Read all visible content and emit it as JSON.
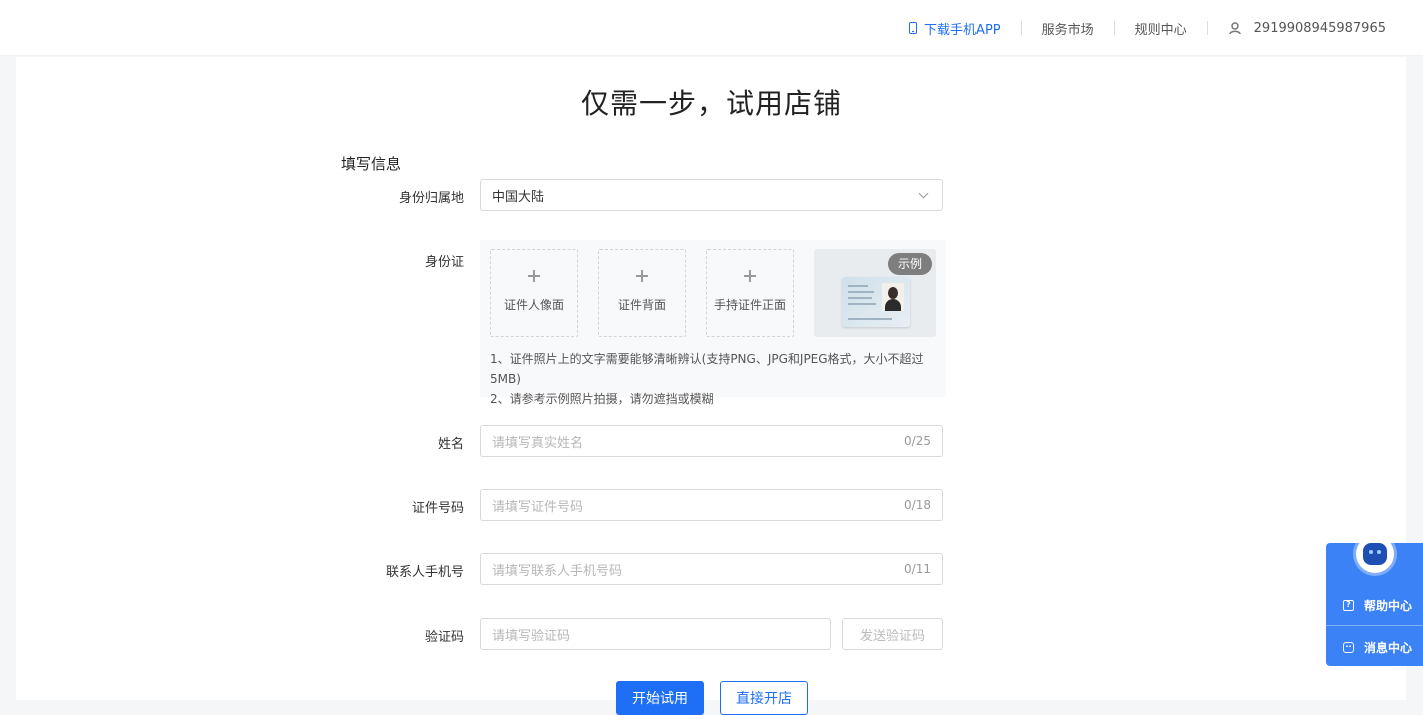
{
  "header": {
    "download_app": "下载手机APP",
    "service_market": "服务市场",
    "rules_center": "规则中心",
    "user_id": "2919908945987965"
  },
  "page": {
    "title": "仅需一步，试用店铺"
  },
  "form": {
    "section_title": "填写信息",
    "region": {
      "label": "身份归属地",
      "value": "中国大陆"
    },
    "id_card": {
      "label": "身份证",
      "upload_front": "证件人像面",
      "upload_back": "证件背面",
      "upload_handheld": "手持证件正面",
      "sample_badge": "示例",
      "tip1": "1、证件照片上的文字需要能够清晰辨认(支持PNG、JPG和JPEG格式，大小不超过5MB)",
      "tip2": "2、请参考示例照片拍摄，请勿遮挡或模糊"
    },
    "name": {
      "label": "姓名",
      "placeholder": "请填写真实姓名",
      "count": "0/25"
    },
    "id_number": {
      "label": "证件号码",
      "placeholder": "请填写证件号码",
      "count": "0/18"
    },
    "phone": {
      "label": "联系人手机号",
      "placeholder": "请填写联系人手机号码",
      "count": "0/11"
    },
    "code": {
      "label": "验证码",
      "placeholder": "请填写验证码",
      "send_button": "发送验证码"
    }
  },
  "actions": {
    "start_trial": "开始试用",
    "open_shop": "直接开店"
  },
  "help_widget": {
    "help_center": "帮助中心",
    "message_center": "消息中心"
  }
}
